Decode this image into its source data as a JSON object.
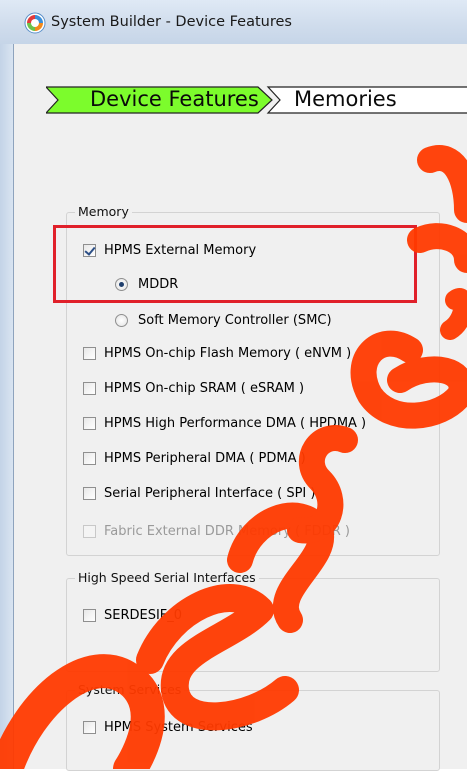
{
  "window": {
    "title": "System Builder - Device Features"
  },
  "wizard": {
    "steps": [
      {
        "label": "Device Features",
        "active": true,
        "color": "#7cfc2c"
      },
      {
        "label": "Memories",
        "active": false,
        "color": "#ffffff"
      }
    ]
  },
  "groups": {
    "memory": {
      "legend": "Memory",
      "items": [
        {
          "type": "checkbox",
          "label": "HPMS External Memory",
          "checked": true,
          "enabled": true
        },
        {
          "type": "radio",
          "label": "MDDR",
          "selected": true
        },
        {
          "type": "radio",
          "label": "Soft Memory Controller (SMC)",
          "selected": false
        },
        {
          "type": "checkbox",
          "label": "HPMS On-chip Flash Memory ( eNVM )",
          "checked": false,
          "enabled": true
        },
        {
          "type": "checkbox",
          "label": "HPMS On-chip SRAM ( eSRAM )",
          "checked": false,
          "enabled": true
        },
        {
          "type": "checkbox",
          "label": "HPMS High Performance DMA ( HPDMA )",
          "checked": false,
          "enabled": true
        },
        {
          "type": "checkbox",
          "label": "HPMS Peripheral DMA ( PDMA )",
          "checked": false,
          "enabled": true
        },
        {
          "type": "checkbox",
          "label": "Serial Peripheral Interface ( SPI )",
          "checked": false,
          "enabled": true
        },
        {
          "type": "checkbox",
          "label": "Fabric External DDR Memory ( FDDR )",
          "checked": false,
          "enabled": false
        }
      ]
    },
    "serial": {
      "legend": "High Speed Serial Interfaces",
      "items": [
        {
          "type": "checkbox",
          "label": "SERDESIF_0",
          "checked": false,
          "enabled": true
        }
      ]
    },
    "services": {
      "legend": "System Services",
      "items": [
        {
          "type": "checkbox",
          "label": "HPMS System Services",
          "checked": false,
          "enabled": true
        }
      ]
    }
  },
  "annotation": {
    "highlight_color": "#e0202a"
  },
  "watermark": {
    "color": "#ff3a00"
  }
}
